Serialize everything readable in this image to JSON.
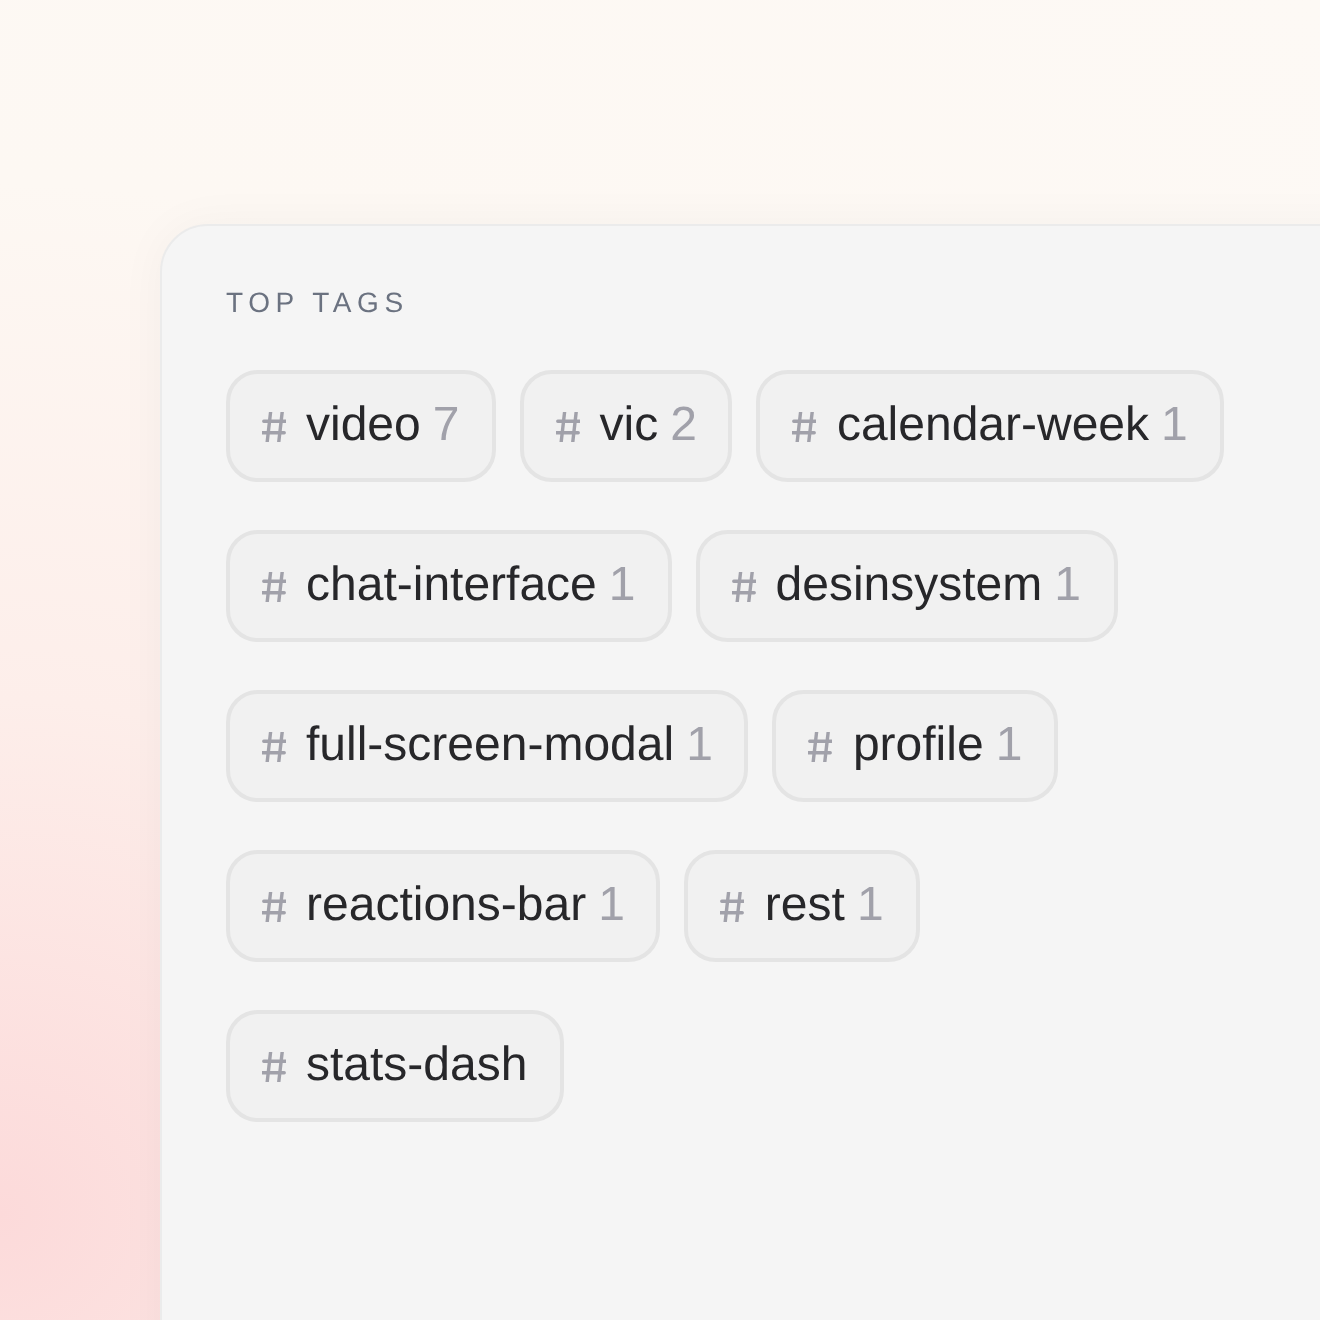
{
  "panel": {
    "title": "TOP TAGS",
    "tags": [
      {
        "name": "video",
        "count": "7"
      },
      {
        "name": "vic",
        "count": "2"
      },
      {
        "name": "calendar-week",
        "count": "1"
      },
      {
        "name": "chat-interface",
        "count": "1"
      },
      {
        "name": "desinsystem",
        "count": "1"
      },
      {
        "name": "full-screen-modal",
        "count": "1"
      },
      {
        "name": "profile",
        "count": "1"
      },
      {
        "name": "reactions-bar",
        "count": "1"
      },
      {
        "name": "rest",
        "count": "1"
      },
      {
        "name": "stats-dash"
      }
    ]
  }
}
